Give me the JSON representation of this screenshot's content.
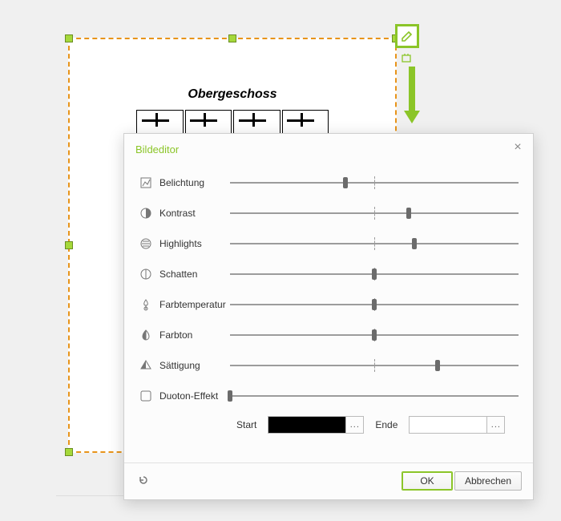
{
  "canvas": {
    "title": "Obergeschoss"
  },
  "dialog": {
    "title": "Bildeditor",
    "sliders": [
      {
        "label": "Belichtung",
        "pos": 40,
        "tick": true
      },
      {
        "label": "Kontrast",
        "pos": 62,
        "tick": true
      },
      {
        "label": "Highlights",
        "pos": 64,
        "tick": true
      },
      {
        "label": "Schatten",
        "pos": 50,
        "tick": true
      },
      {
        "label": "Farbtemperatur",
        "pos": 50,
        "tick": true
      },
      {
        "label": "Farbton",
        "pos": 50,
        "tick": true
      },
      {
        "label": "Sättigung",
        "pos": 72,
        "tick": true
      },
      {
        "label": "Duoton-Effekt",
        "pos": 0,
        "tick": false
      }
    ],
    "duoton": {
      "start_label": "Start",
      "end_label": "Ende",
      "start_color": "#000000",
      "end_color": "#ffffff",
      "more": "..."
    },
    "buttons": {
      "ok": "OK",
      "cancel": "Abbrechen"
    }
  }
}
